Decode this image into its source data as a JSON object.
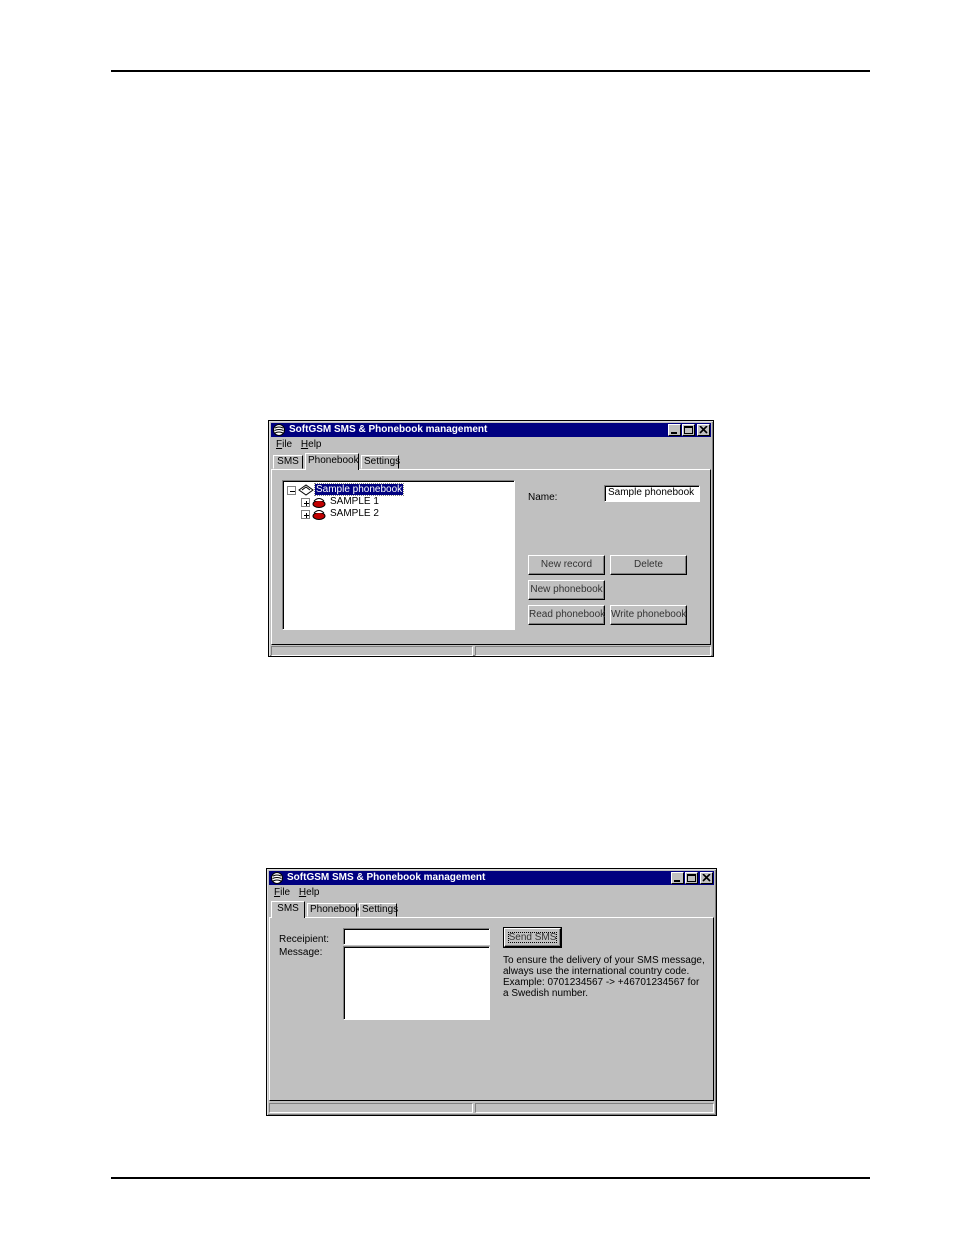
{
  "window_title": "SoftGSM SMS & Phonebook management",
  "menu": [
    {
      "label_first": "F",
      "label_rest": "ile"
    },
    {
      "label_first": "H",
      "label_rest": "elp"
    }
  ],
  "tabs": {
    "sms": "SMS",
    "phonebook": "Phonebook",
    "settings": "Settings"
  },
  "phonebook_window": {
    "tree": {
      "root": "Sample phonebook",
      "children": [
        "SAMPLE 1",
        "SAMPLE 2"
      ]
    },
    "name_label": "Name:",
    "name_value": "Sample phonebook",
    "buttons": {
      "new_record": "New record",
      "delete": "Delete",
      "new_phonebook": "New phonebook",
      "read_phonebook": "Read phonebook",
      "write_phonebook": "Write phonebook"
    }
  },
  "sms_window": {
    "recipient_label": "Receipient:",
    "message_label": "Message:",
    "recipient_value": "",
    "message_value": "",
    "send_button": "Send SMS",
    "help_text": [
      "To ensure the delivery of your SMS message,",
      "always use the international country code.",
      "Example: 0701234567 -> +46701234567 for",
      "a Swedish number."
    ]
  },
  "colors": {
    "titlebar": "#000080",
    "face": "#c0c0c0",
    "selection": "#000080"
  }
}
